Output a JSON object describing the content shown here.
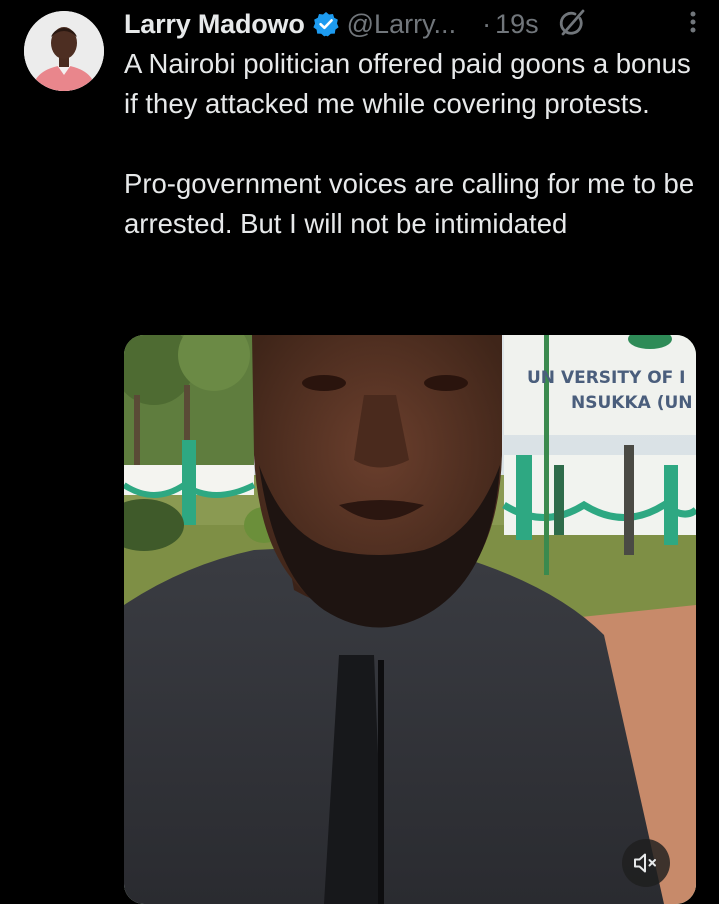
{
  "tweet": {
    "author_name": "Larry Madowo",
    "handle": "@Larry...",
    "separator": "·",
    "timestamp": "19s",
    "paragraphs": [
      "A Nairobi politician offered paid goons a bonus if they attacked me while covering protests.",
      "Pro-government voices are calling for me to be arrested. But I will not be intimidated"
    ]
  },
  "media": {
    "sign_line1": "UN VERSITY OF I",
    "sign_line2": "NSUKKA (UN",
    "mute_icon": "speaker-muted-icon"
  },
  "icons": {
    "verified": "verified-badge-icon",
    "grok": "grok-icon",
    "more": "more-vertical-icon"
  },
  "colors": {
    "background": "#000000",
    "text": "#e7e9ea",
    "secondary": "#71767b",
    "verified": "#1d9bf0"
  }
}
